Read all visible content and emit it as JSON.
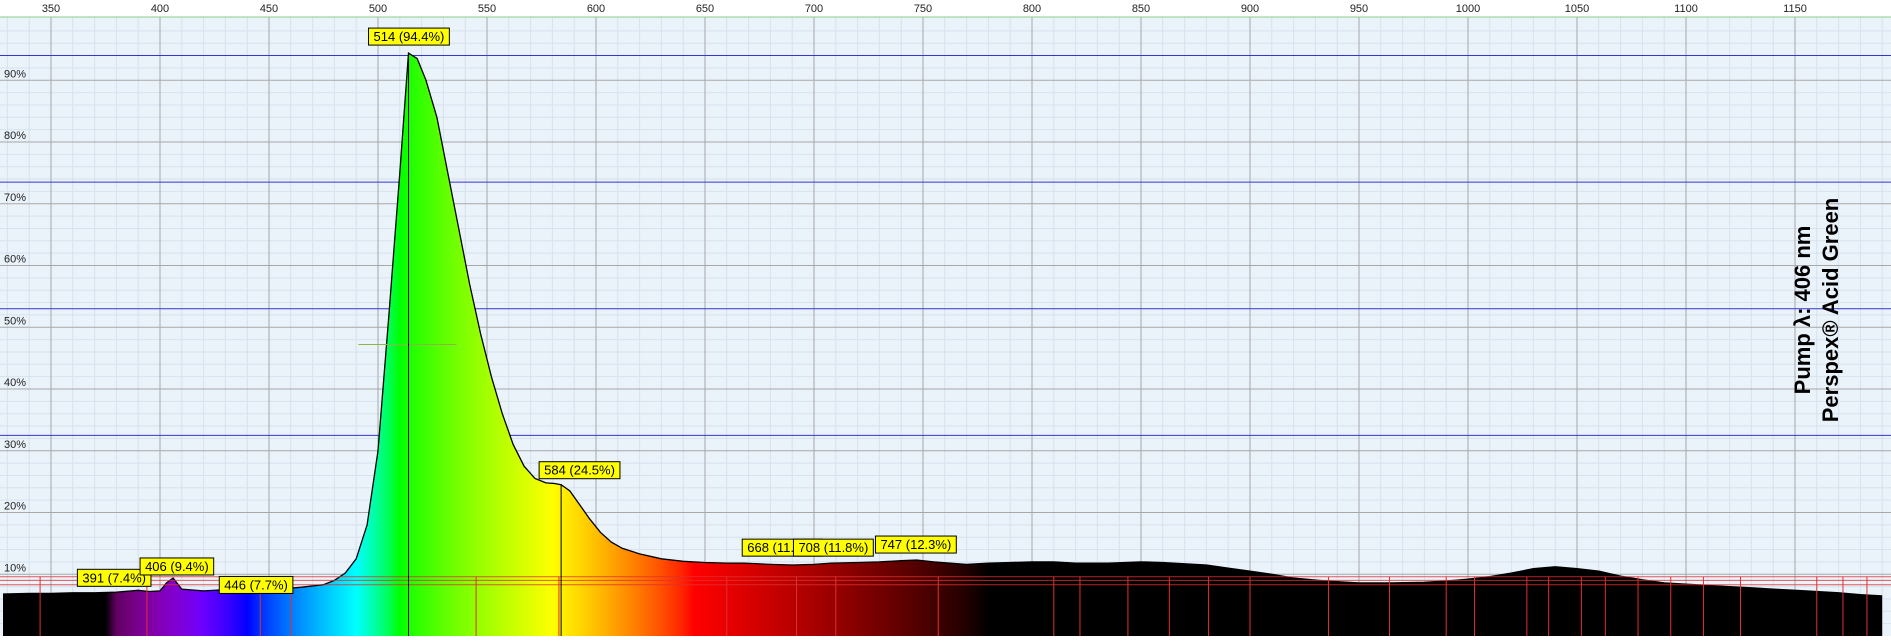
{
  "chart_data": {
    "type": "area",
    "title_lines": [
      "Pump λ: 406 nm",
      "Perspex® Acid Green"
    ],
    "xlabel": "",
    "ylabel": "",
    "xlim": [
      328,
      1190
    ],
    "ylim": [
      0,
      100
    ],
    "x_unit": "nm",
    "grid": true,
    "x_ticks": [
      350,
      400,
      450,
      500,
      550,
      600,
      650,
      700,
      750,
      800,
      850,
      900,
      950,
      1000,
      1050,
      1100,
      1150
    ],
    "x_tick_labels": [
      "350",
      "400",
      "450",
      "500",
      "550",
      "600",
      "650",
      "700",
      "750",
      "800",
      "850",
      "900",
      "950",
      "1000",
      "1050",
      "1100",
      "1150"
    ],
    "y_ticks": [
      10,
      20,
      30,
      40,
      50,
      60,
      70,
      80,
      90
    ],
    "y_tick_labels": [
      "10%",
      "20%",
      "30%",
      "40%",
      "50%",
      "60%",
      "70%",
      "80%",
      "90%"
    ],
    "series": [
      {
        "x": [
          328,
          340,
          350,
          360,
          370,
          380,
          390,
          395,
          400,
          403,
          406,
          410,
          420,
          430,
          440,
          446,
          455,
          465,
          475,
          480,
          485,
          490,
          495,
          500,
          505,
          510,
          514,
          518,
          522,
          527,
          532,
          537,
          542,
          547,
          552,
          557,
          562,
          567,
          572,
          577,
          581,
          584,
          588,
          592,
          597,
          602,
          607,
          612,
          620,
          630,
          640,
          650,
          660,
          668,
          680,
          690,
          700,
          708,
          720,
          730,
          740,
          747,
          755,
          770,
          780,
          790,
          800,
          810,
          820,
          835,
          850,
          860,
          870,
          880,
          890,
          900,
          910,
          920,
          935,
          950,
          965,
          980,
          990,
          1000,
          1010,
          1020,
          1030,
          1040,
          1050,
          1060,
          1070,
          1080,
          1090,
          1100,
          1110,
          1120,
          1130,
          1140,
          1150,
          1160,
          1170,
          1180,
          1190
        ],
        "values": [
          6.8,
          6.9,
          6.9,
          7.0,
          7.0,
          7.1,
          7.4,
          7.2,
          7.3,
          8.6,
          9.4,
          7.6,
          7.3,
          7.5,
          7.6,
          7.7,
          7.6,
          7.9,
          8.3,
          9.0,
          10.2,
          12.5,
          18.0,
          30.0,
          52.0,
          75.0,
          94.4,
          93.5,
          90.0,
          84.0,
          75.0,
          66.0,
          57.0,
          49.0,
          42.0,
          36.0,
          31.0,
          27.5,
          25.5,
          24.8,
          24.7,
          24.5,
          23.5,
          21.5,
          19.0,
          16.8,
          15.2,
          14.2,
          13.3,
          12.5,
          12.1,
          11.9,
          11.8,
          11.8,
          11.6,
          11.5,
          11.6,
          11.8,
          11.9,
          12.0,
          12.2,
          12.3,
          12.0,
          11.6,
          11.8,
          11.9,
          12.0,
          12.0,
          11.8,
          11.8,
          12.0,
          11.9,
          11.7,
          11.5,
          11.0,
          10.5,
          10.0,
          9.4,
          8.9,
          8.6,
          8.6,
          8.7,
          8.9,
          9.2,
          9.6,
          10.2,
          10.9,
          11.2,
          10.9,
          10.5,
          9.7,
          9.1,
          8.6,
          8.4,
          8.2,
          8.0,
          7.8,
          7.6,
          7.4,
          7.2,
          7.0,
          6.7,
          6.5
        ]
      }
    ],
    "peak_labels": [
      {
        "x": 391,
        "y": 7.4,
        "text": "391 (7.4%)"
      },
      {
        "x": 406,
        "y": 9.4,
        "text": "406 (9.4%)"
      },
      {
        "x": 446,
        "y": 7.7,
        "text": "446 (7.7%)"
      },
      {
        "x": 514,
        "y": 94.4,
        "text": "514 (94.4%)"
      },
      {
        "x": 584,
        "y": 24.5,
        "text": "584 (24.5%)"
      },
      {
        "x": 668,
        "y": 11.8,
        "text": "668 (11.8%)"
      },
      {
        "x": 708,
        "y": 11.8,
        "text": "708 (11.8%)"
      },
      {
        "x": 747,
        "y": 12.3,
        "text": "747 (12.3%)"
      }
    ],
    "reference_lines_y": [
      94,
      73.5,
      53,
      32.5
    ],
    "fwhm_marker": {
      "y": 47.2,
      "x1": 491,
      "x2": 536
    },
    "red_marker_lines_x": [
      345,
      394,
      446,
      460,
      545,
      583,
      660,
      692,
      710,
      757,
      810,
      822,
      844,
      863,
      881,
      900,
      936,
      964,
      990,
      1003,
      1027,
      1037,
      1052,
      1063,
      1078,
      1093,
      1108,
      1125,
      1160,
      1172,
      1183
    ],
    "colors": {
      "grid_major": "#a8a8a8",
      "grid_minor": "#d6e2ee",
      "reference_line": "#3535d0",
      "red_band": "#e03030",
      "label_fill": "#ffff00",
      "label_border": "#000000",
      "top_frame": "#88cc88"
    }
  }
}
